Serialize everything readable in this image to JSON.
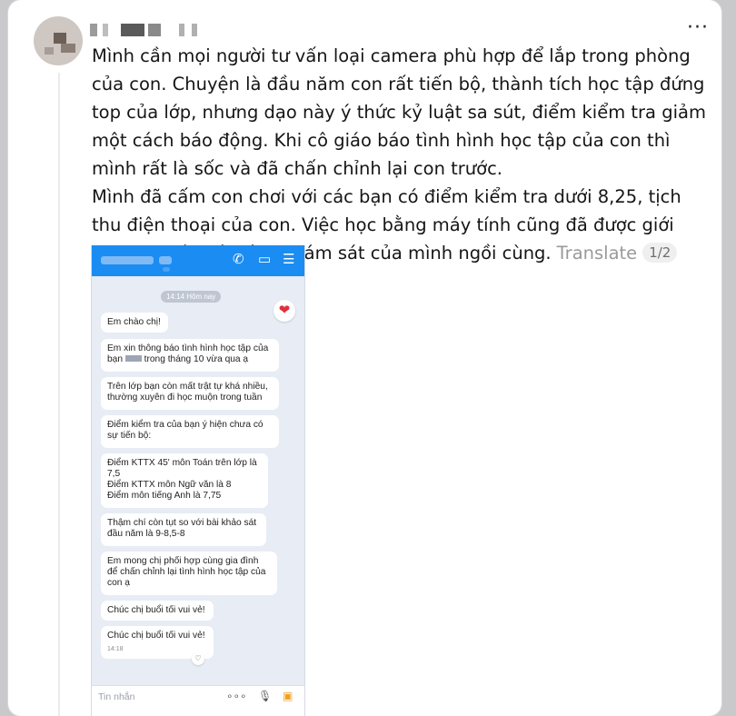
{
  "post": {
    "more_label": "···",
    "paragraph1": "Mình cần mọi người tư vấn loại camera phù hợp để lắp trong phòng của con. Chuyện là đầu năm con rất tiến bộ, thành tích học tập đứng top của lớp, nhưng dạo này ý thức kỷ luật sa sút, điểm kiểm tra giảm một cách báo động. Khi cô giáo báo tình hình học tập của con thì mình rất là sốc và đã chấn chỉnh lại con trước.",
    "paragraph2": "Mình đã cấm con chơi với các bạn có điểm kiểm tra dưới 8,25, tịch thu điện thoại của con. Việc học bằng máy tính cũng đã được giới hạn 2h/ngày và có sự giám sát của mình ngồi cùng.",
    "translate_label": "Translate",
    "page_indicator": "1/2"
  },
  "chat": {
    "header_icons": [
      "phone-icon",
      "video-icon",
      "list-icon"
    ],
    "timestamp": "14:14 Hôm nay",
    "messages": [
      {
        "text": "Em chào chị!"
      },
      {
        "text_before": "Em xin thông báo tình hình học tập của\nbạn ",
        "text_after": " trong tháng 10 vừa qua ạ"
      },
      {
        "text": "Trên lớp bạn còn mất trật tự khá nhiều,\nthường xuyên đi học muộn trong tuần"
      },
      {
        "text": "Điểm kiểm tra của bạn ý hiện chưa có\nsự tiến bộ:"
      },
      {
        "text": "Điểm KTTX 45' môn Toán trên lớp là\n7,5\nĐiểm KTTX môn Ngữ văn là 8\nĐiểm môn tiếng Anh là 7,75"
      },
      {
        "text": "Thậm chí còn tụt so với bài khảo sát\nđầu năm là 9-8,5-8"
      },
      {
        "text": "Em mong chị phối hợp cùng gia đình\nđể chấn chỉnh lại tình hình học tập của\ncon ạ"
      },
      {
        "text": "Chúc chị buổi tối vui vẻ!"
      },
      {
        "text": "Chúc chị buổi tối vui vẻ!",
        "time": "14:18"
      }
    ],
    "input_placeholder": "Tin nhắn",
    "input_icons": [
      "more-icon",
      "mic-icon",
      "image-icon"
    ]
  },
  "colors": {
    "chat_header": "#1a8cf2",
    "chat_background": "#e7ecf5",
    "heart": "#e0303a"
  }
}
